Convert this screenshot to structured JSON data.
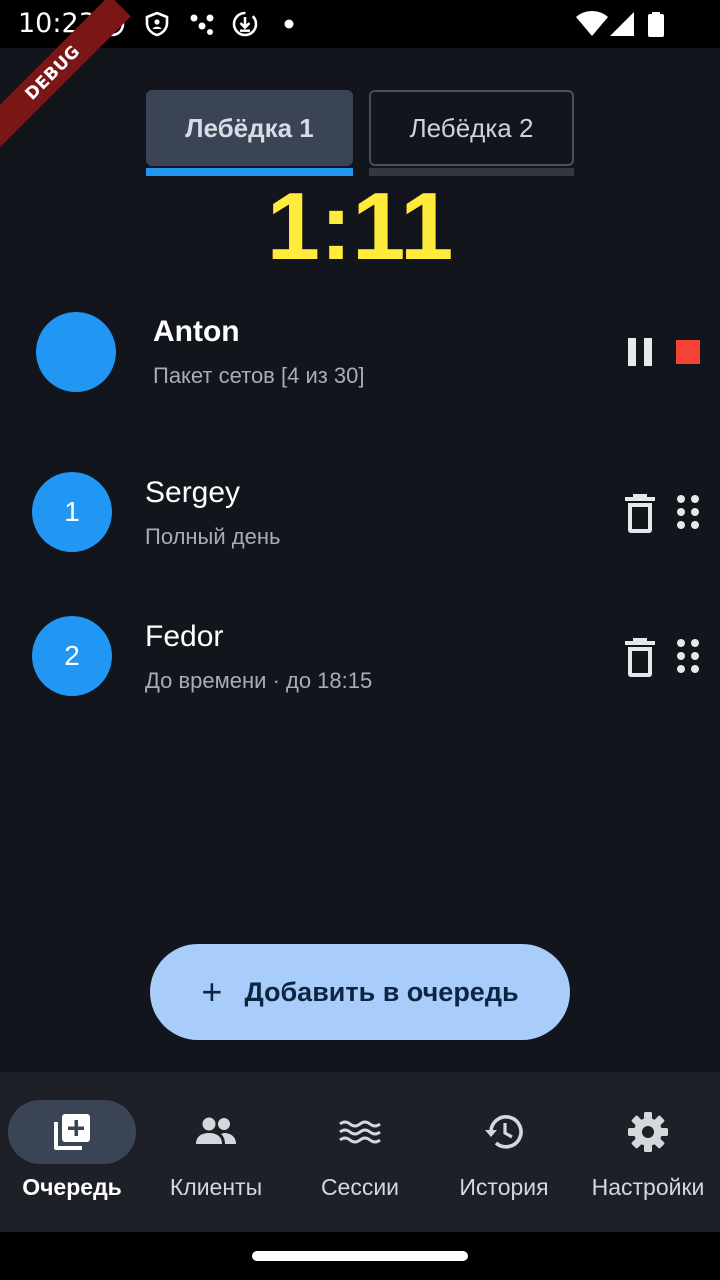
{
  "status": {
    "time": "10:23"
  },
  "debug_label": "DEBUG",
  "tabs": [
    {
      "label": "Лебёдка 1",
      "selected": true
    },
    {
      "label": "Лебёдка 2",
      "selected": false
    }
  ],
  "timer": "1:11",
  "current": {
    "name": "Anton",
    "subtitle": "Пакет сетов [4 из 30]"
  },
  "queue": [
    {
      "number": "1",
      "name": "Sergey",
      "subtitle": "Полный день"
    },
    {
      "number": "2",
      "name": "Fedor",
      "subtitle": "До времени · до 18:15"
    }
  ],
  "fab": {
    "label": "Добавить в очередь",
    "icon": "plus-icon"
  },
  "nav": [
    {
      "label": "Очередь",
      "icon": "queue-add-icon",
      "active": true
    },
    {
      "label": "Клиенты",
      "icon": "people-icon",
      "active": false
    },
    {
      "label": "Сессии",
      "icon": "waves-icon",
      "active": false
    },
    {
      "label": "История",
      "icon": "history-icon",
      "active": false
    },
    {
      "label": "Настройки",
      "icon": "gear-icon",
      "active": false
    }
  ],
  "colors": {
    "background": "#12151b",
    "accent": "#2196f3",
    "timer": "#ffeb3b",
    "stop": "#f44336",
    "fab": "#a8cdfb"
  }
}
